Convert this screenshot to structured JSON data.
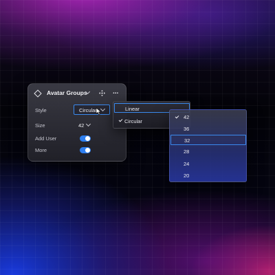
{
  "panel": {
    "title": "Avatar Groups",
    "rows": {
      "style_label": "Style",
      "style_value": "Circular",
      "size_label": "Size",
      "size_value": "42",
      "add_user_label": "Add User",
      "add_user_on": true,
      "more_label": "More",
      "more_on": true
    },
    "more_icon": "..."
  },
  "style_menu": {
    "options": [
      "Linear",
      "Circular"
    ],
    "highlighted": "Linear",
    "checked": "Circular"
  },
  "size_menu": {
    "options": [
      "42",
      "36",
      "32",
      "28",
      "24",
      "20"
    ],
    "checked": "42",
    "highlighted": "32"
  },
  "colors": {
    "accent": "#2e7ff0",
    "focus_border": "#3a8bf0"
  },
  "icons": [
    "diamond-icon",
    "chevron-down-icon",
    "move-icon",
    "more-icon",
    "check-icon",
    "cursor-icon"
  ]
}
